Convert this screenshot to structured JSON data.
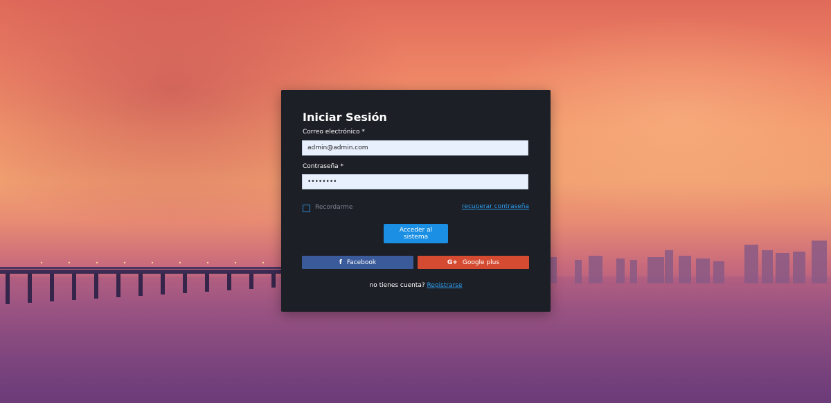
{
  "login": {
    "title": "Iniciar Sesión",
    "email_label": "Correo electrónico *",
    "email_value": "admin@admin.com",
    "password_label": "Contraseña *",
    "password_value": "12345678",
    "remember_label": "Recordarme",
    "recover_link": "recuperar contraseña",
    "submit_label": "Acceder al sistema",
    "facebook_label": "Facebook",
    "google_label": "Google plus",
    "no_account_text": "no tienes cuenta?",
    "register_link": "Registrarse"
  },
  "icons": {
    "facebook": "f",
    "google": "G+"
  },
  "colors": {
    "card_bg": "#1c1f26",
    "input_bg": "#e8f0fe",
    "primary": "#1a8fe3",
    "link": "#2e9ef0",
    "facebook": "#3b5a9a",
    "google": "#d44b32"
  }
}
